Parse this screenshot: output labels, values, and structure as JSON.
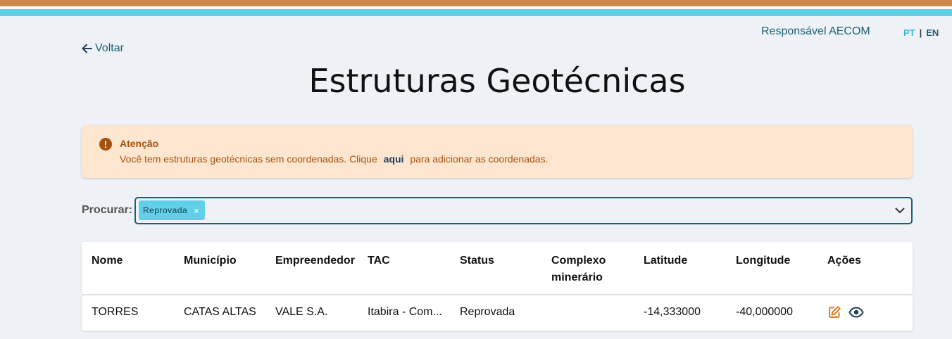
{
  "header": {
    "user_name": "Responsável AECOM",
    "lang_pt": "PT",
    "lang_sep": "|",
    "lang_en": "EN"
  },
  "nav": {
    "back_label": "Voltar",
    "back_icon": "arrow-left-icon"
  },
  "page": {
    "title": "Estruturas Geotécnicas"
  },
  "alert": {
    "title": "Atenção",
    "message_before": "Você tem estruturas geotécnicas sem coordenadas. Clique",
    "link_text": "aqui",
    "message_after": "para adicionar as coordenadas.",
    "icon": "exclamation-circle-icon",
    "color": "#a5520f",
    "background": "#fde6d0"
  },
  "search": {
    "label": "Procurar:",
    "chips": [
      "Reprovada"
    ],
    "chip_remove": "×",
    "dropdown_icon": "chevron-down-icon"
  },
  "table": {
    "columns": [
      "Nome",
      "Município",
      "Empreendedor",
      "TAC",
      "Status",
      "Complexo minerário",
      "Latitude",
      "Longitude",
      "Ações"
    ],
    "rows": [
      {
        "nome": "TORRES",
        "municipio": "CATAS ALTAS",
        "empreendedor": "VALE S.A.",
        "tac": "Itabira - Com...",
        "status": "Reprovada",
        "complexo": "",
        "latitude": "-14,333000",
        "longitude": "-40,000000",
        "actions": [
          "edit-icon",
          "eye-icon"
        ]
      }
    ]
  },
  "colors": {
    "accent_teal": "#1f5f73",
    "accent_cyan": "#5fd0e8",
    "accent_orange": "#cd8a4a",
    "action_orange": "#e07a1f"
  }
}
